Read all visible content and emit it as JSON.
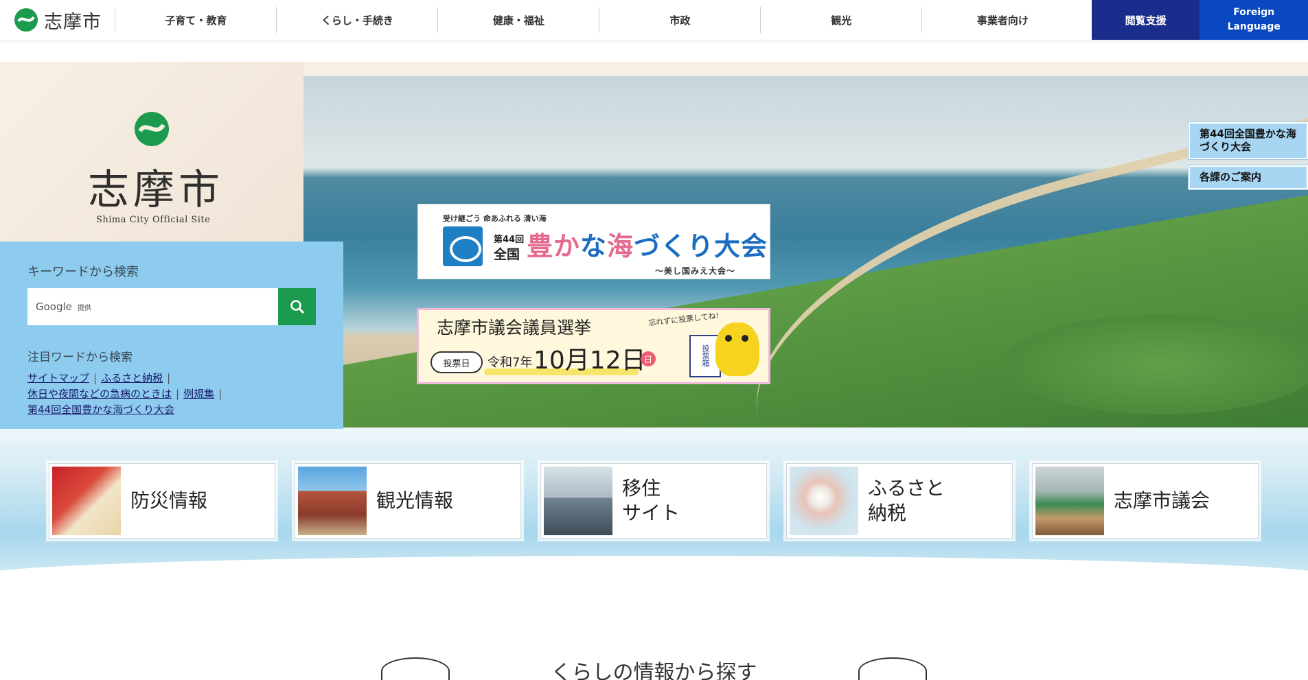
{
  "header": {
    "logo_text": "志摩市",
    "nav": [
      "子育て・教育",
      "くらし・手続き",
      "健康・福祉",
      "市政",
      "観光",
      "事業者向け"
    ],
    "access_label": "閲覧支援",
    "lang_label_1": "Foreign",
    "lang_label_2": "Language"
  },
  "brand": {
    "title": "志摩市",
    "subtitle": "Shima City Official Site",
    "green": "#1c9a4e"
  },
  "banner_fest": {
    "tagline": "受け継ごう 命あふれる 清い海",
    "count": "第44回",
    "kokko": "全国",
    "title_a": "豊か",
    "title_b": "な",
    "title_c": "海",
    "title_d": "づくり大会",
    "sub": "〜美し国みえ大会〜"
  },
  "banner_election": {
    "title": "志摩市議会議員選挙",
    "pill": "投票日",
    "date_pre": "令和7年",
    "date": "10月12日",
    "day": "日",
    "note": "忘れずに投票してね!",
    "box": "投票箱"
  },
  "side_buttons": {
    "fest": "第44回全国豊かな海づくり大会",
    "guide": "各課のご案内"
  },
  "search": {
    "label": "キーワードから検索",
    "google": "Google",
    "provided": "提供",
    "featured_label": "注目ワードから検索",
    "links": [
      "サイトマップ",
      "ふるさと納税",
      "休日や夜間などの急病のときは",
      "例規集",
      "第44回全国豊かな海づくり大会"
    ]
  },
  "cards": [
    {
      "label": "防災情報",
      "icon": "disaster-kit-photo"
    },
    {
      "label": "観光情報",
      "icon": "statue-photo"
    },
    {
      "label": "移住サイト",
      "label_1": "移住",
      "label_2": "サイト",
      "icon": "surfer-photo"
    },
    {
      "label": "ふるさと納税",
      "label_1": "ふるさと",
      "label_2": "納税",
      "icon": "pearl-photo"
    },
    {
      "label": "志摩市議会",
      "icon": "assembly-hall-photo"
    }
  ],
  "bottom_heading": "くらしの情報から探す",
  "colors": {
    "access_bg": "#1a2d8c",
    "lang_bg": "#0a48c2",
    "search_panel": "#8dccef",
    "side_btn": "#a7d5f2"
  }
}
